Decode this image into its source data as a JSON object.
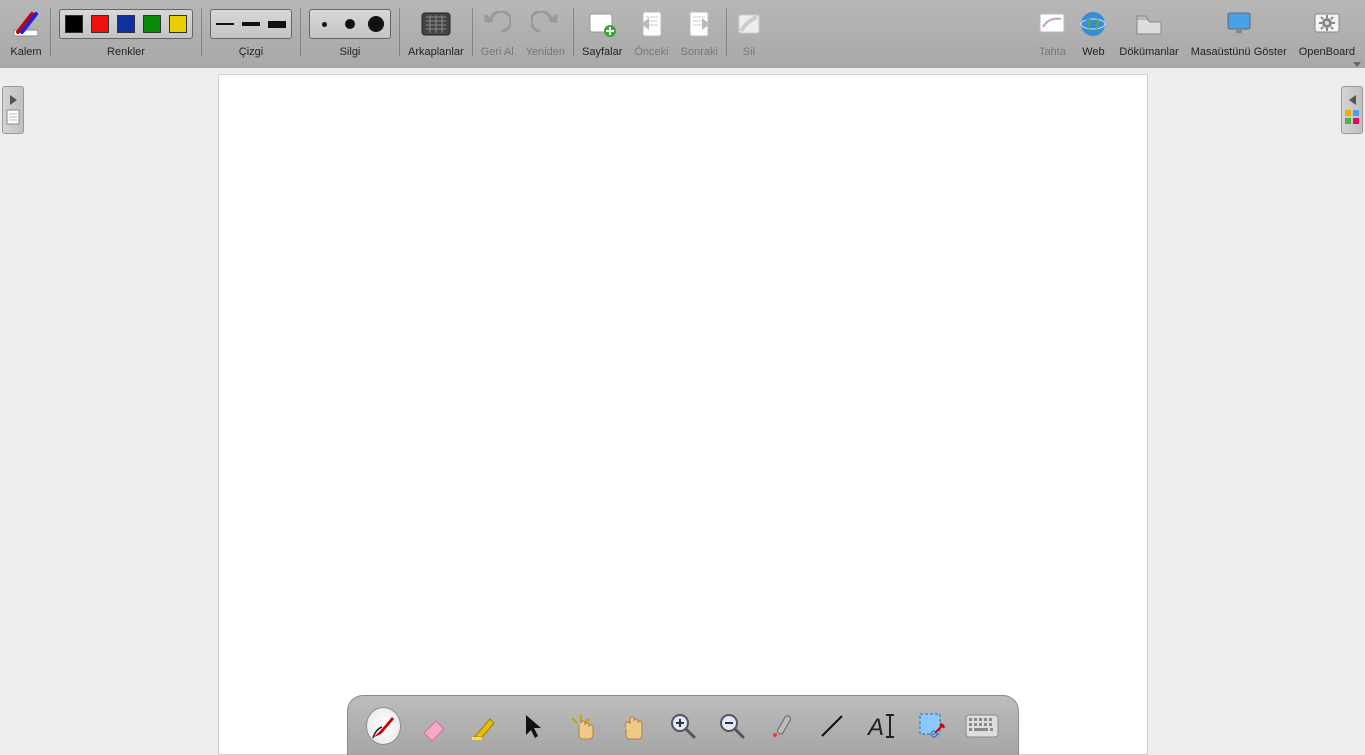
{
  "toolbar": {
    "pen": {
      "label": "Kalem"
    },
    "colors": {
      "label": "Renkler",
      "swatches": [
        "#000000",
        "#e11",
        "#1030a0",
        "#0a8a0a",
        "#e8d000"
      ]
    },
    "line": {
      "label": "Çizgi"
    },
    "eraser": {
      "label": "Silgi"
    },
    "backgrounds": {
      "label": "Arkaplanlar"
    },
    "undo": {
      "label": "Geri Al"
    },
    "redo": {
      "label": "Yeniden"
    },
    "pages": {
      "label": "Sayfalar"
    },
    "prev": {
      "label": "Önceki"
    },
    "next": {
      "label": "Sonraki"
    },
    "delete": {
      "label": "Sil"
    },
    "board": {
      "label": "Tahta"
    },
    "web": {
      "label": "Web"
    },
    "documents": {
      "label": "Dökümanlar"
    },
    "desktop": {
      "label": "Masaüstünü Göster"
    },
    "openboard": {
      "label": "OpenBoard"
    }
  },
  "dock": {
    "tools": [
      {
        "name": "pen",
        "selected": true
      },
      {
        "name": "eraser",
        "selected": false
      },
      {
        "name": "highlighter",
        "selected": false
      },
      {
        "name": "selector",
        "selected": false
      },
      {
        "name": "interact",
        "selected": false
      },
      {
        "name": "hand",
        "selected": false
      },
      {
        "name": "zoom-in",
        "selected": false
      },
      {
        "name": "zoom-out",
        "selected": false
      },
      {
        "name": "laser",
        "selected": false
      },
      {
        "name": "line",
        "selected": false
      },
      {
        "name": "text",
        "selected": false
      },
      {
        "name": "capture",
        "selected": false
      },
      {
        "name": "keyboard",
        "selected": false
      }
    ]
  }
}
